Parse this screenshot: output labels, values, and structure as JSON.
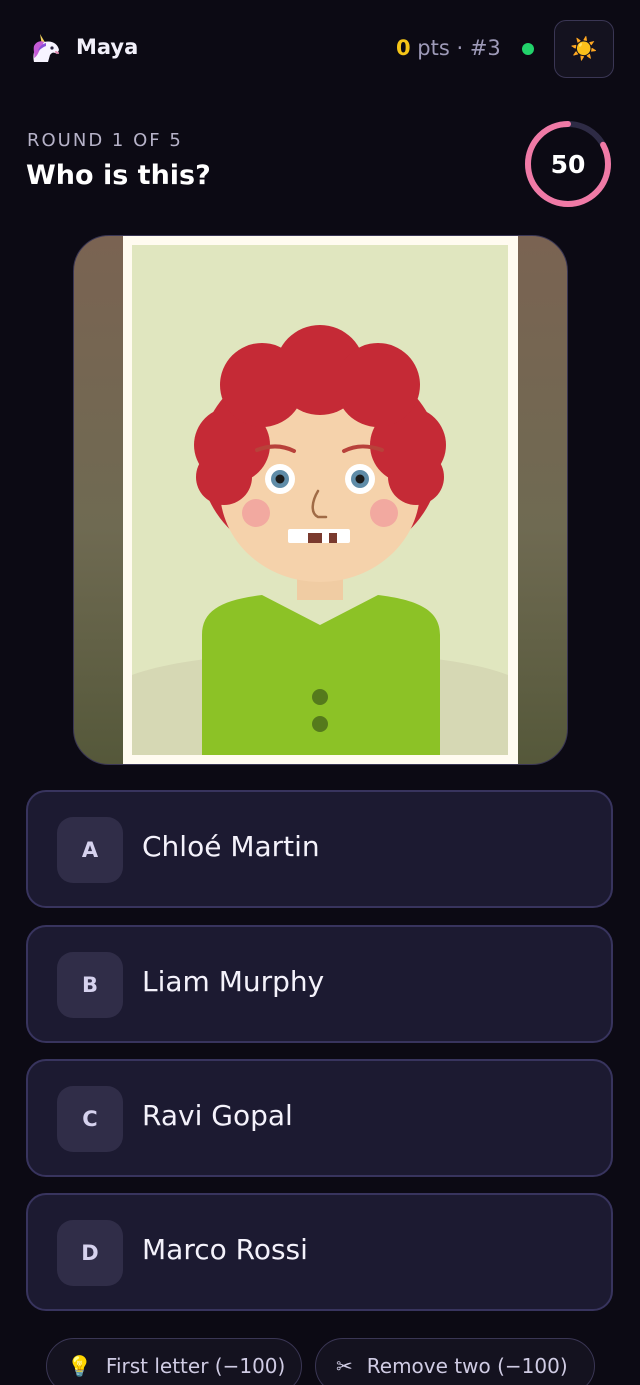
{
  "header": {
    "avatar_icon": "unicorn-icon",
    "avatar_glyph": "🦄",
    "username": "Maya",
    "points": "0",
    "points_suffix": " pts · #3",
    "online_color": "#22d36b",
    "theme_icon": "sun-icon",
    "theme_glyph": "☀️"
  },
  "round": {
    "label": "ROUND 1 OF 5",
    "question": "Who is this?",
    "timer_value": "50",
    "timer_remaining_fraction": 0.83,
    "timer_color": "#f07aa6"
  },
  "answers": [
    {
      "letter": "A",
      "name": "Chloé Martin"
    },
    {
      "letter": "B",
      "name": "Liam Murphy"
    },
    {
      "letter": "C",
      "name": "Ravi Gopal"
    },
    {
      "letter": "D",
      "name": "Marco Rossi"
    }
  ],
  "lifelines": [
    {
      "icon": "lightbulb-icon",
      "glyph": "💡",
      "label": "First letter (−100)"
    },
    {
      "icon": "scissors-icon",
      "glyph": "✂",
      "label": "Remove two (−100)"
    }
  ]
}
